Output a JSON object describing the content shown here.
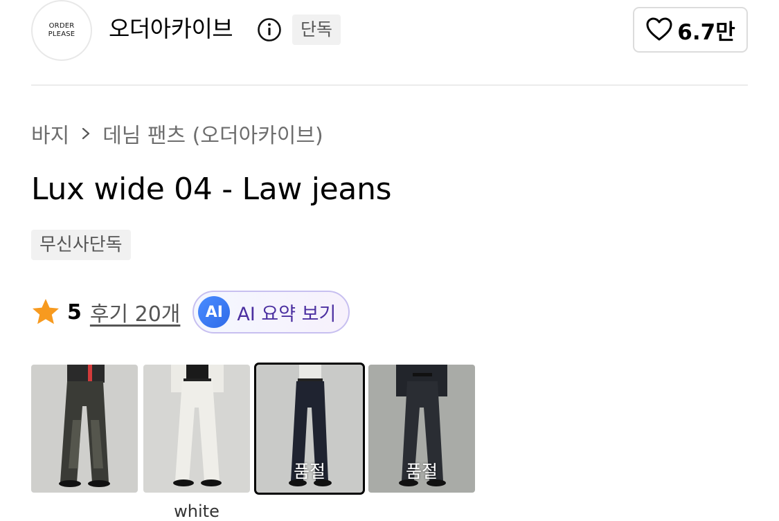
{
  "brand": {
    "logo_line1": "ORDER",
    "logo_line2": "PLEASE",
    "name": "오더아카이브",
    "badge": "단독",
    "likes": "6.7만"
  },
  "breadcrumb": {
    "category": "바지",
    "subcategory": "데님 팬츠 (오더아카이브)"
  },
  "product": {
    "title": "Lux wide 04 - Law jeans",
    "tag": "무신사단독"
  },
  "rating": {
    "score": "5",
    "reviews": "후기 20개",
    "ai_badge": "AI",
    "ai_label": "AI 요약 보기"
  },
  "colors": {
    "star": "#f79a1f",
    "ai_text": "#4b2fa0",
    "ai_badge": "#3a7af0"
  },
  "variants": [
    {
      "name": "",
      "soldout": "",
      "selected": false,
      "style": "dark-washed"
    },
    {
      "name": "white",
      "soldout": "",
      "selected": false,
      "style": "white"
    },
    {
      "name": "",
      "soldout": "품절",
      "selected": true,
      "style": "dark-navy"
    },
    {
      "name": "",
      "soldout": "품절",
      "selected": false,
      "style": "black"
    }
  ]
}
